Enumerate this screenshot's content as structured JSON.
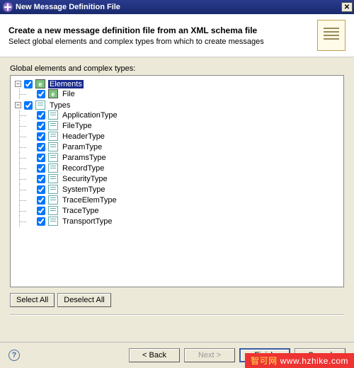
{
  "window": {
    "title": "New Message Definition File"
  },
  "header": {
    "title": "Create a new message definition file from an XML schema file",
    "subtitle": "Select global elements and complex types from which to create messages"
  },
  "section_label": "Global elements and complex types:",
  "tree": {
    "elements_label": "Elements",
    "elements_children": [
      {
        "label": "File"
      }
    ],
    "types_label": "Types",
    "types_children": [
      {
        "label": "ApplicationType"
      },
      {
        "label": "FileType"
      },
      {
        "label": "HeaderType"
      },
      {
        "label": "ParamType"
      },
      {
        "label": "ParamsType"
      },
      {
        "label": "RecordType"
      },
      {
        "label": "SecurityType"
      },
      {
        "label": "SystemType"
      },
      {
        "label": "TraceElemType"
      },
      {
        "label": "TraceType"
      },
      {
        "label": "TransportType"
      }
    ]
  },
  "buttons": {
    "select_all": "Select All",
    "deselect_all": "Deselect All",
    "back": "< Back",
    "next": "Next >",
    "finish": "Finish",
    "cancel": "Cancel"
  },
  "watermark": {
    "pre": "智可网",
    "url": "www.hzhike.com"
  },
  "glyphs": {
    "minus": "−",
    "e": "e",
    "help": "?"
  }
}
